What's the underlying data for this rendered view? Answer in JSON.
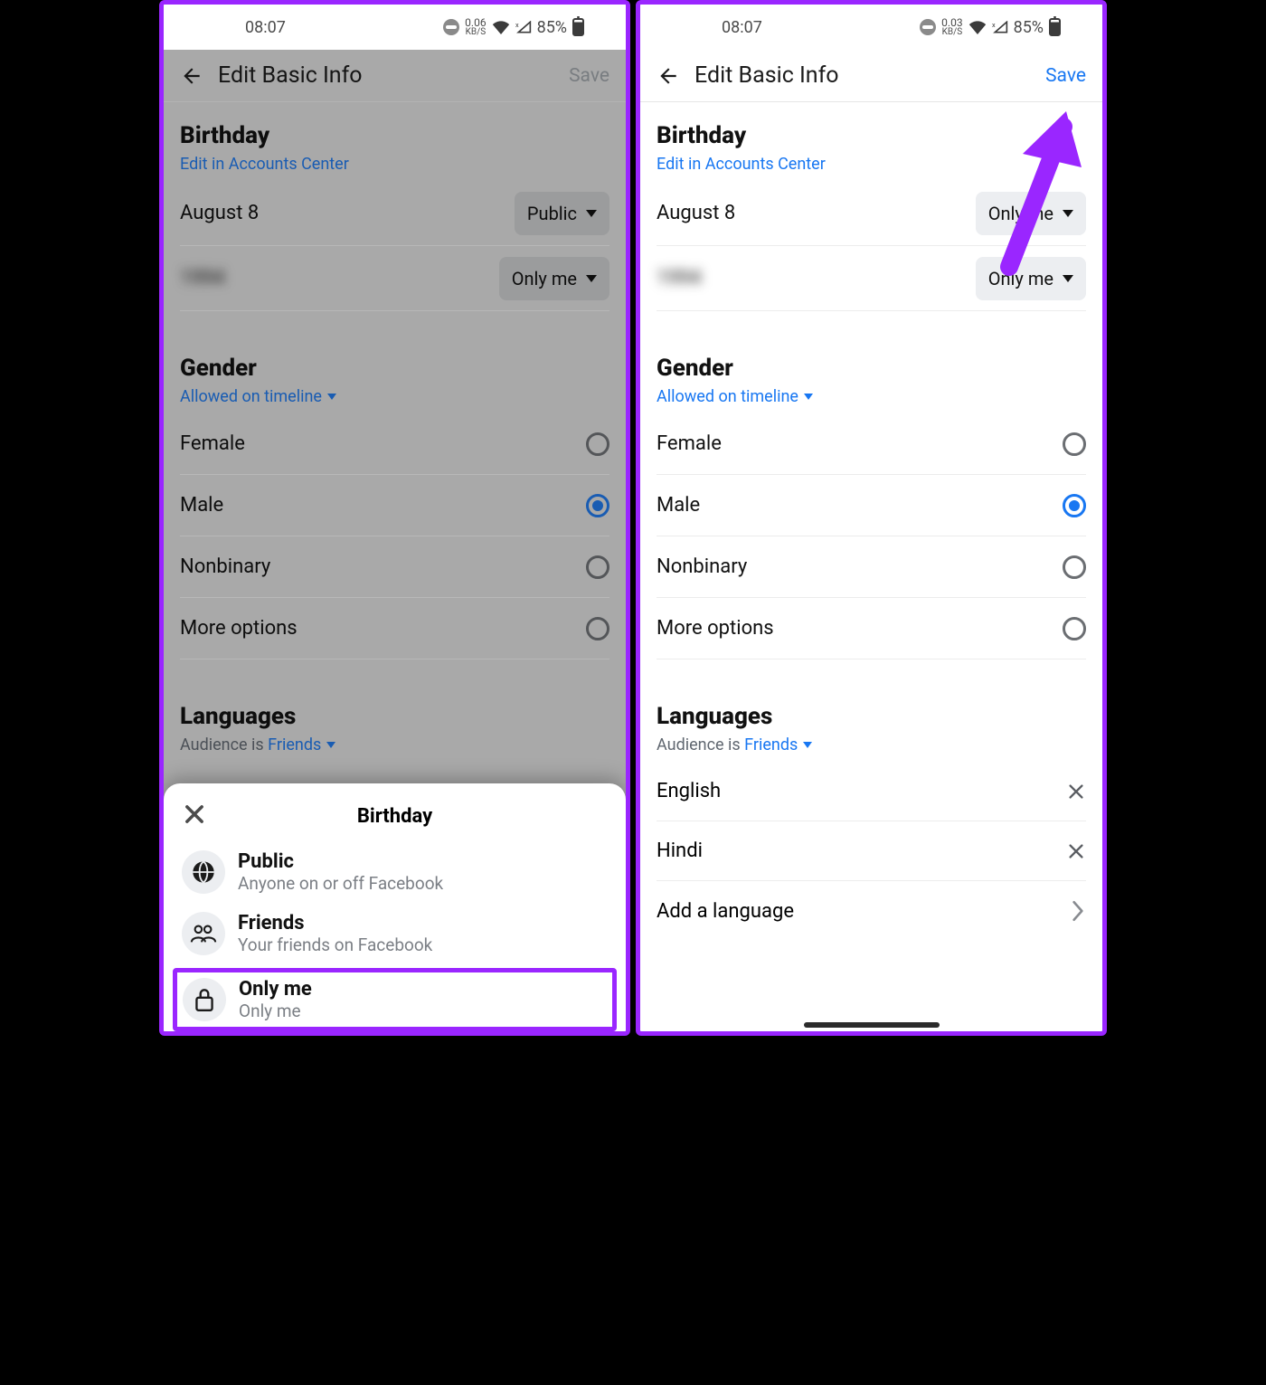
{
  "status": {
    "time": "08:07",
    "kbs_left": "0.06",
    "kbs_right": "0.03",
    "kbs_unit": "KB/S",
    "battery": "85%"
  },
  "appbar": {
    "title": "Edit Basic Info",
    "save": "Save"
  },
  "birthday": {
    "title": "Birthday",
    "edit_link": "Edit in Accounts Center",
    "date": "August 8",
    "date_privacy": "Public",
    "year_blur": "1994",
    "year_privacy": "Only me",
    "date_privacy_right": "Only me"
  },
  "gender": {
    "title": "Gender",
    "sub": "Allowed on timeline",
    "options": [
      "Female",
      "Male",
      "Nonbinary",
      "More options"
    ],
    "selected": "Male"
  },
  "languages": {
    "title": "Languages",
    "sub_prefix": "Audience is ",
    "sub_link": "Friends",
    "items": [
      "English",
      "Hindi"
    ],
    "add": "Add a language"
  },
  "sheet": {
    "title": "Birthday",
    "options": [
      {
        "title": "Public",
        "sub": "Anyone on or off Facebook",
        "icon": "globe"
      },
      {
        "title": "Friends",
        "sub": "Your friends on Facebook",
        "icon": "friends"
      },
      {
        "title": "Only me",
        "sub": "Only me",
        "icon": "lock"
      }
    ]
  }
}
